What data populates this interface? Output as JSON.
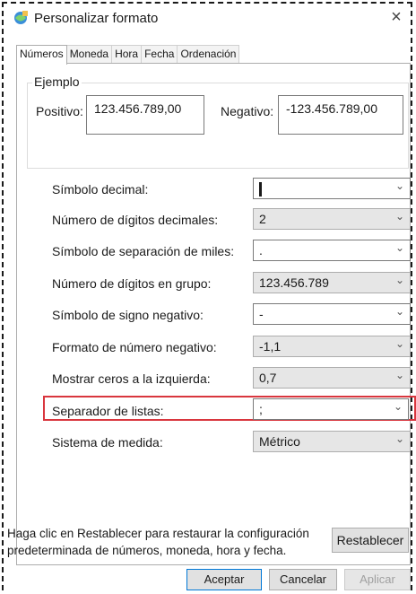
{
  "window": {
    "title": "Personalizar formato"
  },
  "tabs": [
    {
      "label": "Números"
    },
    {
      "label": "Moneda"
    },
    {
      "label": "Hora"
    },
    {
      "label": "Fecha"
    },
    {
      "label": "Ordenación"
    }
  ],
  "example": {
    "legend": "Ejemplo",
    "positive_label": "Positivo:",
    "positive_value": "123.456.789,00",
    "negative_label": "Negativo:",
    "negative_value": "-123.456.789,00"
  },
  "settings": [
    {
      "label": "Símbolo decimal:",
      "value": ""
    },
    {
      "label": "Número de dígitos decimales:",
      "value": "2"
    },
    {
      "label": "Símbolo de separación de miles:",
      "value": "."
    },
    {
      "label": "Número de dígitos en grupo:",
      "value": "123.456.789"
    },
    {
      "label": "Símbolo de signo negativo:",
      "value": "-"
    },
    {
      "label": "Formato de número negativo:",
      "value": "-1,1"
    },
    {
      "label": "Mostrar ceros a la izquierda:",
      "value": "0,7"
    },
    {
      "label": "Separador de listas:",
      "value": ";"
    },
    {
      "label": "Sistema de medida:",
      "value": "Métrico"
    }
  ],
  "footer": {
    "help_text_line1": "Haga clic en Restablecer para restaurar la configuración",
    "help_text_line2": "predeterminada de números, moneda, hora y fecha.",
    "reset_label": "Restablecer",
    "ok_label": "Aceptar",
    "cancel_label": "Cancelar",
    "apply_label": "Aplicar"
  },
  "colors": {
    "highlight": "#d9363e",
    "primary_border": "#0078d7"
  }
}
